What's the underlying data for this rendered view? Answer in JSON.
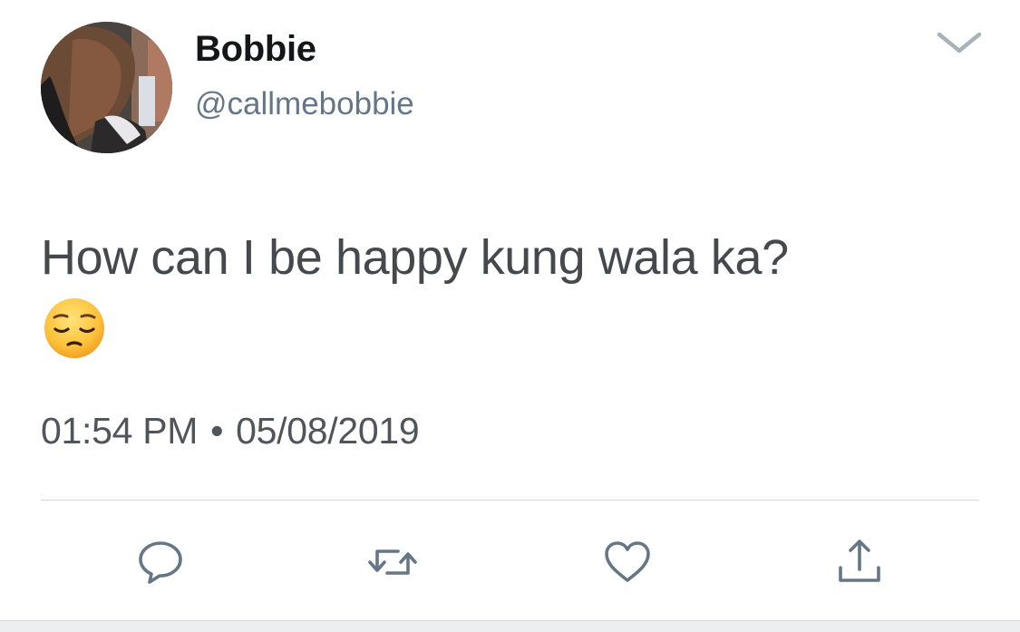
{
  "author": {
    "display_name": "Bobbie",
    "handle": "@callmebobbie"
  },
  "tweet": {
    "text": "How can I be happy kung wala ka?",
    "emoji": "pensive-face",
    "time": "01:54 PM",
    "separator": "•",
    "date": "05/08/2019"
  },
  "icons": {
    "caret": "chevron-down-icon",
    "reply": "reply-icon",
    "retweet": "retweet-icon",
    "like": "heart-icon",
    "share": "share-icon"
  },
  "colors": {
    "text_primary": "#14171a",
    "text_secondary": "#657786",
    "icon_gray": "#657786",
    "divider": "#cfd4d8"
  }
}
